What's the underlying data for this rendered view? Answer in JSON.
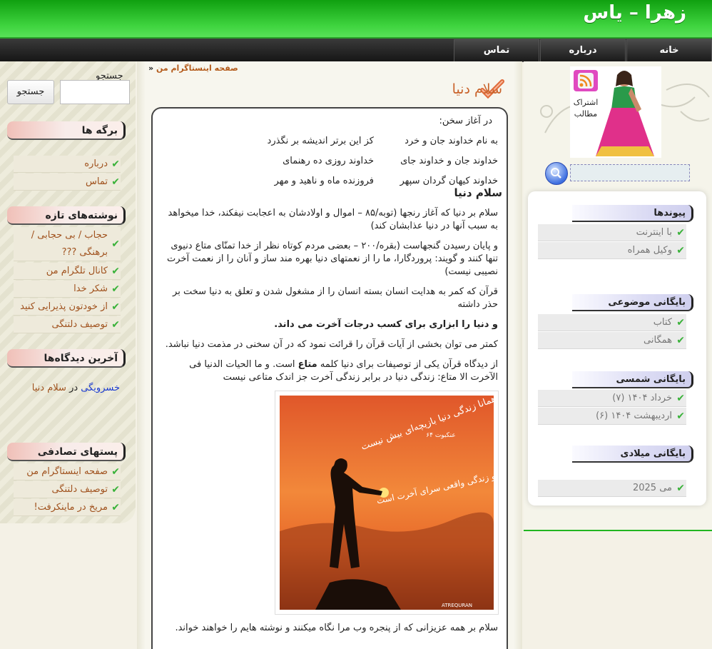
{
  "header": {
    "site_title": "زهرا – یاس"
  },
  "nav": [
    "خانه",
    "درباره",
    "تماس"
  ],
  "search": {
    "label": "جستجو",
    "button": "جستجو",
    "value": ""
  },
  "pages_box": {
    "title": "برگه ها",
    "items": [
      "درباره",
      "تماس"
    ]
  },
  "recent_posts": {
    "title": "نوشته‌های تازه",
    "items": [
      "حجاب / بی حجابی / برهنگی ???",
      "کانال تلگرام من",
      "شکر خدا",
      "از خودتون پذیرایی کنید",
      "توصیف دلتنگی"
    ]
  },
  "recent_comments": {
    "title": "آخرین دیدگاه‌ها",
    "author": "خسرویگی",
    "in": "در",
    "post": "سلام دنیا"
  },
  "random_posts": {
    "title": "پستهای تصادفی",
    "items": [
      "صفحه اینستاگرام من",
      "توصیف دلتنگی",
      "مریخ در ماینکرفت!"
    ]
  },
  "breadcrumb": {
    "text": "صفحه اینستاگرام من",
    "arrow": "»"
  },
  "post": {
    "title": "سلام دنیا",
    "intro": "در آغاز سخن:",
    "poem": [
      [
        "به نام خداوند جان و خرد",
        "کز این برتر اندیشه بر نگذرد"
      ],
      [
        "خداوند جان و خداوند جای",
        "خداوند روزی ده رهنمای"
      ],
      [
        "خداوند کیهان گردان سپهر",
        "فروزنده ماه و ناهید و مهر"
      ]
    ],
    "heading": "سلام دنیا",
    "p1": "سلام  بر دنیا که آغاز رنجها (توبه/۸۵ – اموال و اولادشان به اعجابت نیفکند، خدا میخواهد به سبب آنها در دنیا عذابشان کند)",
    "p2": "و پایان رسیدن گنجهاست (بقره/۲۰۰ – بعضی مردم کوتاه نظر از خدا تمنّای متاع دنیوی تنها کنند و گویند: پروردگارا، ما را از نعمتهای دنیا بهره مند ساز و آنان را از نعمت آخرت نصیبی نیست)",
    "p3": "قرآن که کمر به هدایت انسان بسته انسان را از مشغول شدن و تعلق به دنیا سخت بر حذر داشته",
    "p4": "و دنیا را ابزاری برای کسب درجات آخرت می داند.",
    "p5": "کمتر می توان بخشی از آیات  قرآن را قرائت نمود که در آن سخنی در مذمت دنیا نباشد.",
    "p6a": "از دیدگاه قرآن یکی از توصیفات برای دنیا کلمه ",
    "p6b": "متاع",
    "p6c": " است. و ما الحیات الدنیا فی الآخرت الا متاع: زندگی دنیا در برابر زندگی آخرت جز اندک متاعی نیست",
    "image_caption_line1": "همانا زندگی دنیا بازیچه‌ای بیش نیست",
    "image_caption_line2": "و زندگی واقعی سرای آخرت است",
    "image_ref": "عنکبوت ۶۴",
    "image_watermark": "ATREQURAN",
    "closing": "سلام بر همه عزیزانی که از پنجره وب مرا نگاه میکنند و نوشته هایم را خواهند خواند."
  },
  "sidebar_right": {
    "subscribe": "اشتراک مطالب",
    "links": {
      "title": "پیوندها",
      "items": [
        "با اینترنت",
        "وکیل همراه"
      ]
    },
    "topic_archive": {
      "title": "بایگانی موضوعی",
      "items": [
        "کتاب",
        "همگانی"
      ]
    },
    "solar_archive": {
      "title": "بایگانی شمسی",
      "items": [
        "خرداد ۱۴۰۴ (۷)",
        "اردیبهشت ۱۴۰۴ (۶)"
      ]
    },
    "gregorian_archive": {
      "title": "بایگانی میلادی",
      "items": [
        "می 2025"
      ]
    }
  },
  "colors": {
    "header_green": "#2ec42e",
    "link_orange": "#a0521e",
    "title_orange": "#c9622a",
    "check_green": "#3ab23a"
  }
}
